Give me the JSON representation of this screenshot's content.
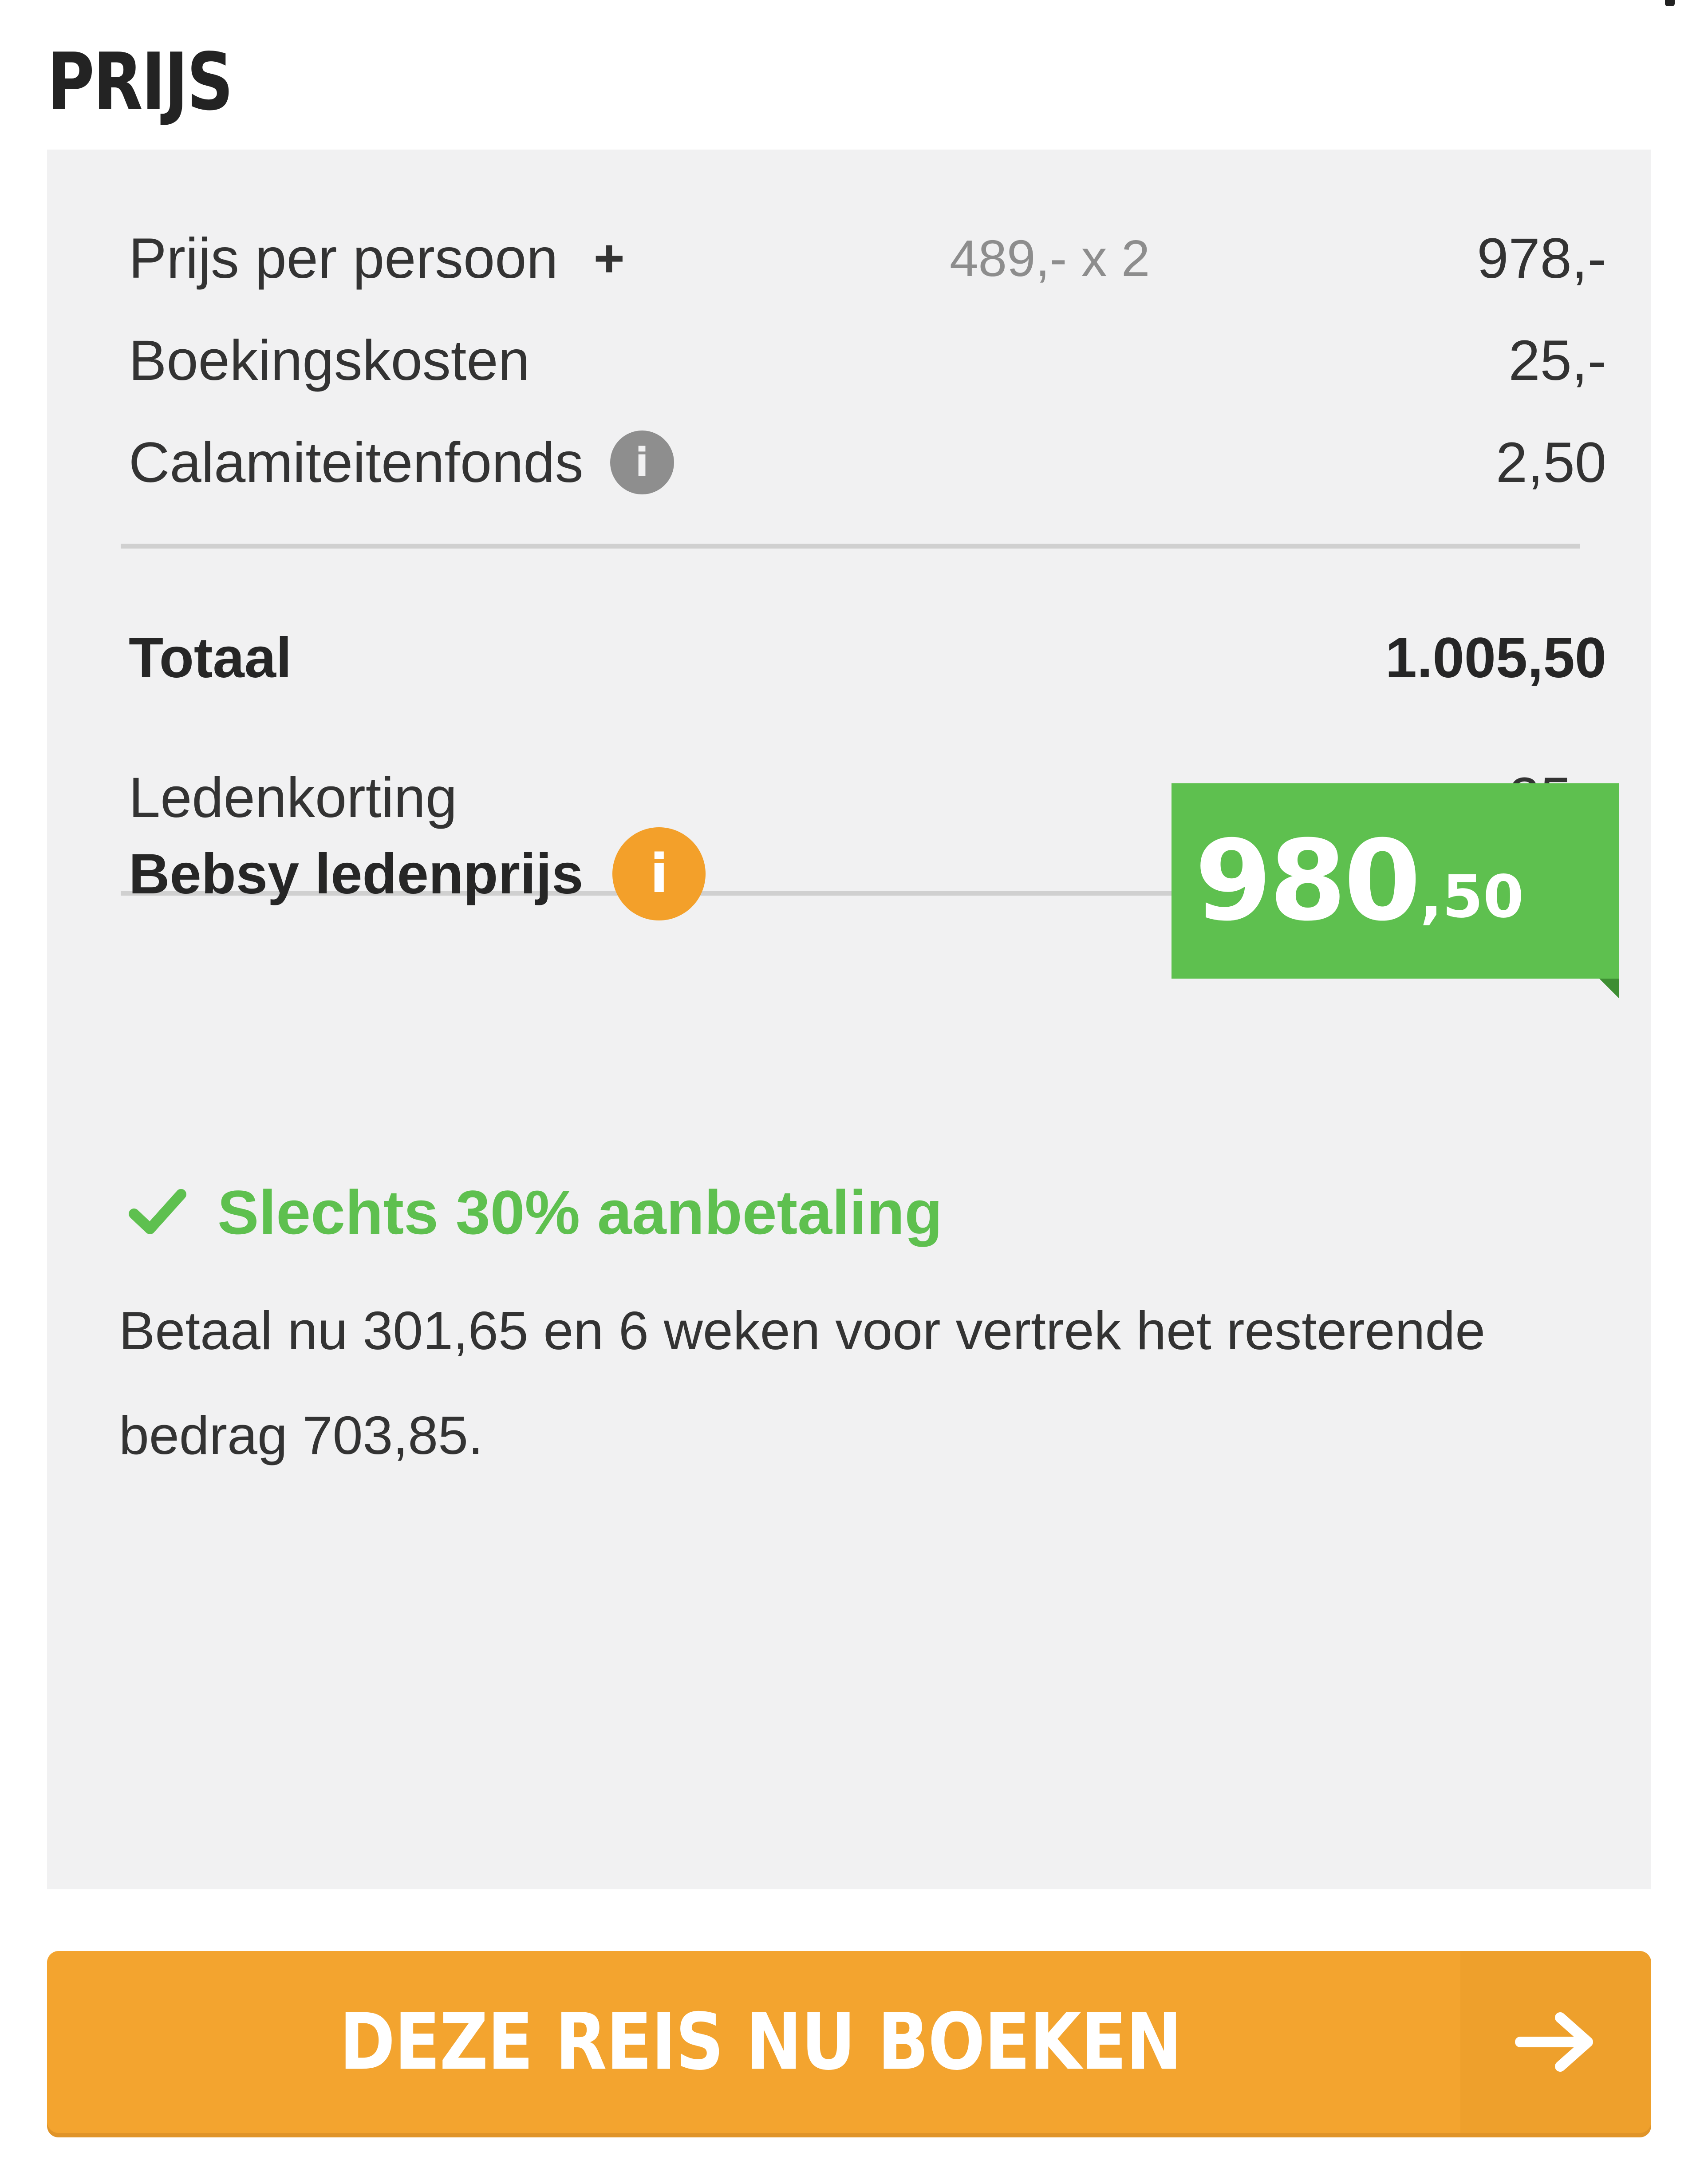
{
  "section": {
    "title": "PRIJS"
  },
  "price_lines": [
    {
      "label": "Prijs per persoon",
      "detail": "489,- x 2",
      "amount": "978,-"
    },
    {
      "label": "Boekingskosten",
      "amount": "25,-"
    },
    {
      "label": "Calamiteitenfonds",
      "amount": "2,50"
    }
  ],
  "icons": {
    "expand": "plus-icon",
    "info": "info-icon",
    "check": "check-icon",
    "arrow": "arrow-right-icon",
    "plus_glyph": "+",
    "info_glyph": "i"
  },
  "total": {
    "label": "Totaal",
    "amount": "1.005,50"
  },
  "discount": {
    "label": "Ledenkorting",
    "amount": "- 25,-"
  },
  "member_price": {
    "label": "Bebsy ledenprijs",
    "main": "980",
    "cents": ",50"
  },
  "deposit": {
    "heading": "Slechts 30% aanbetaling",
    "text": "Betaal nu 301,65 en 6 weken voor vertrek het resterende bedrag 703,85."
  },
  "cta": {
    "label": "DEZE REIS NU BOEKEN"
  },
  "colors": {
    "panel_background": "#f1f1f2",
    "price_badge": "#5ec04f",
    "accent_orange": "#f3a42f",
    "success_green": "#5ec04f",
    "info_grey": "#8e8e8e"
  }
}
